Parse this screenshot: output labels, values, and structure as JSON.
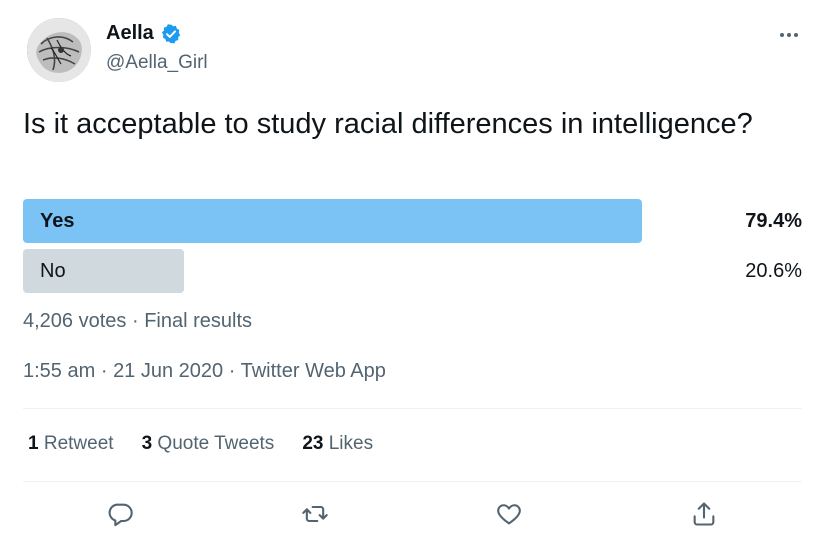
{
  "user": {
    "name": "Aella",
    "handle": "@Aella_Girl",
    "verified_icon": "verified-badge-icon",
    "verified_color": "#1d9bf0"
  },
  "tweet": {
    "text": "Is it acceptable to study racial differences in intelligence?"
  },
  "poll": {
    "options": [
      {
        "label": "Yes",
        "percent_text": "79.4%",
        "percent": 79.4,
        "winner": true,
        "bar_color": "#7cc3f5"
      },
      {
        "label": "No",
        "percent_text": "20.6%",
        "percent": 20.6,
        "winner": false,
        "bar_color": "#cfd9de"
      }
    ],
    "votes_text": "4,206 votes",
    "separator": "·",
    "status_text": "Final results"
  },
  "meta": {
    "time": "1:55 am",
    "separator": "·",
    "date": "21 Jun 2020",
    "source": "Twitter Web App"
  },
  "stats": {
    "retweets_count": "1",
    "retweets_label": "Retweet",
    "quotes_count": "3",
    "quotes_label": "Quote Tweets",
    "likes_count": "23",
    "likes_label": "Likes"
  },
  "actions": [
    {
      "icon": "reply-icon"
    },
    {
      "icon": "retweet-icon"
    },
    {
      "icon": "like-icon"
    },
    {
      "icon": "share-icon"
    }
  ]
}
